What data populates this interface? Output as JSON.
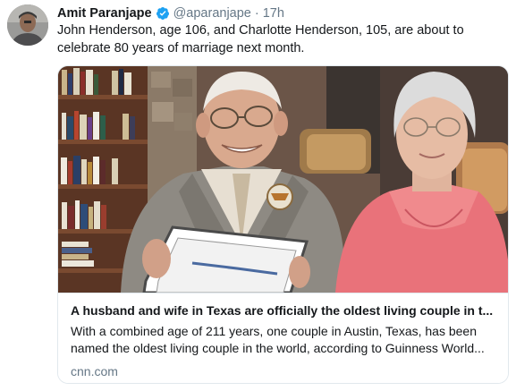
{
  "author": {
    "display_name": "Amit Paranjape",
    "handle": "@aparanjape",
    "separator": "·",
    "timestamp": "17h",
    "verified": true,
    "avatar": "profile-photo"
  },
  "tweet": {
    "text": "John Henderson, age 106, and Charlotte Henderson, 105, are about to celebrate 80 years of marriage next month."
  },
  "card": {
    "image": "photo-elderly-couple-holding-certificate",
    "title": "A husband and wife in Texas are officially the oldest living couple in t...",
    "description": "With a combined age of 211 years, one couple in Austin, Texas, has been\nnamed the oldest living couple in the world, according to Guinness World...",
    "domain": "cnn.com"
  },
  "colors": {
    "text": "#14171a",
    "secondary": "#657786",
    "verified_blue": "#1da1f2",
    "border": "#e1e8ed"
  }
}
